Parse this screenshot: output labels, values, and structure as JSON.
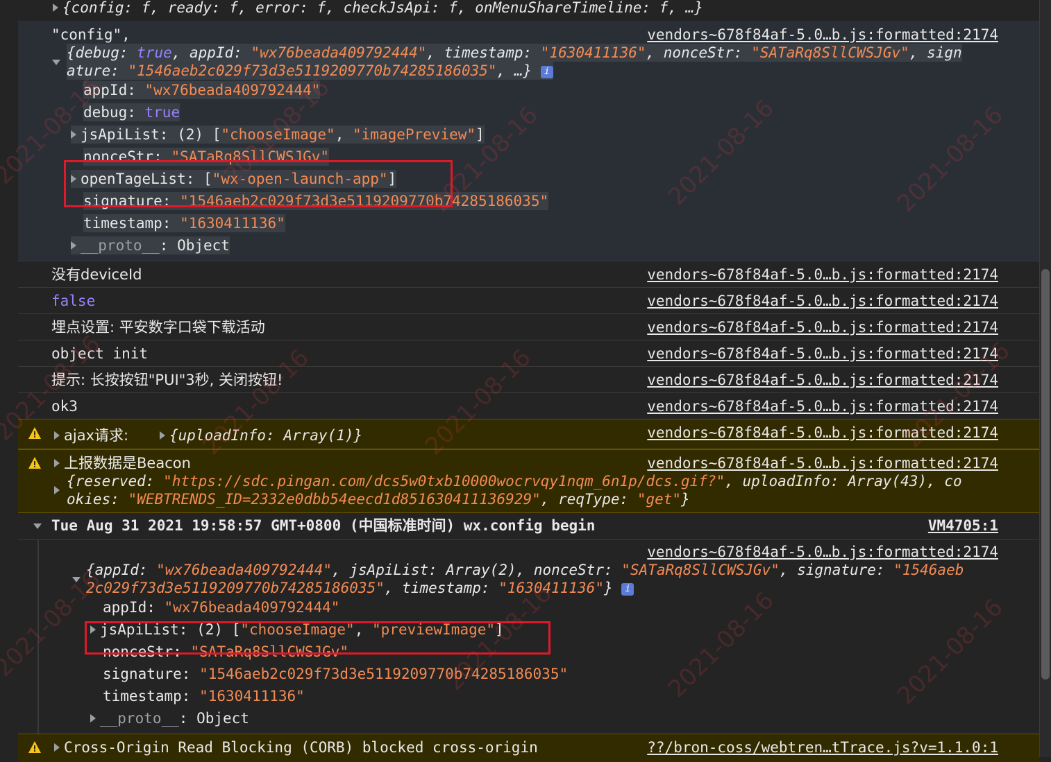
{
  "colors": {
    "background": "#242424",
    "string": "#f28b54",
    "keyword": "#9980ff",
    "warning_bg": "#332b00",
    "highlight": "#e0192a"
  },
  "top_line": "{config: f, ready: f, error: f, checkJsApi: f, onMenuShareTimeline: f, …}",
  "group1": {
    "label": "\"config\",",
    "source": "vendors~678f84af-5.0…b.js:formatted:2174",
    "summary_parts": {
      "open": "{debug: ",
      "debug_val": "true",
      "appid_key": ", appId: ",
      "appid_val": "\"wx76beada409792444\"",
      "ts_key": ", timestamp: ",
      "ts_val": "\"1630411136\"",
      "nonce_key": ", nonceStr: ",
      "nonce_val": "\"SATaRq8SllCWSJGv\"",
      "sign_key": ", sign",
      "line2_key": "ature: ",
      "line2_val": "\"1546aeb2c029f73d3e5119209770b74285186035\"",
      "line2_end": ", …}"
    },
    "info": "i",
    "props": [
      {
        "key": "appId",
        "val": "\"wx76beada409792444\""
      },
      {
        "key": "debug",
        "val": "true"
      },
      {
        "key": "jsApiList",
        "count": "(2)",
        "open": "[",
        "a": "\"chooseImage\"",
        "sep": ", ",
        "b": "\"imagePreview\"",
        "close": "]"
      },
      {
        "key": "nonceStr",
        "val": "\"SATaRq8SllCWSJGv\""
      },
      {
        "key": "openTageList",
        "open": "[",
        "a": "\"wx-open-launch-app\"",
        "close": "]"
      },
      {
        "key": "signature",
        "val": "\"1546aeb2c029f73d3e5119209770b74285186035\""
      },
      {
        "key": "timestamp",
        "val": "\"1630411136\""
      },
      {
        "key": "__proto__",
        "val": "Object"
      }
    ]
  },
  "log_rows": [
    {
      "text": "没有deviceId",
      "source": "vendors~678f84af-5.0…b.js:formatted:2174"
    },
    {
      "text": "false",
      "source": "vendors~678f84af-5.0…b.js:formatted:2174"
    },
    {
      "text": "埋点设置: 平安数字口袋下载活动",
      "source": "vendors~678f84af-5.0…b.js:formatted:2174"
    },
    {
      "text": "object init",
      "source": "vendors~678f84af-5.0…b.js:formatted:2174"
    },
    {
      "text": "提示: 长按按钮\"PUI\"3秒, 关闭按钮!",
      "source": "vendors~678f84af-5.0…b.js:formatted:2174"
    },
    {
      "text": "ok3",
      "source": "vendors~678f84af-5.0…b.js:formatted:2174"
    }
  ],
  "warn1": {
    "label": "ajax请求:",
    "obj": "{uploadInfo: Array(1)}",
    "source": "vendors~678f84af-5.0…b.js:formatted:2174"
  },
  "warn2": {
    "label": "上报数据是Beacon",
    "source": "vendors~678f84af-5.0…b.js:formatted:2174",
    "l1_key": "{reserved: ",
    "l1_val": "\"https://sdc.pingan.com/dcs5w0txb10000wocrvqy1nqm_6n1p/dcs.gif?\"",
    "l1_end": ", uploadInfo: Array(43), co",
    "l2_key": "okies: ",
    "l2_val": "\"WEBTRENDS_ID=2332e0dbb54eecd1d851630411136929\"",
    "l2_mid": ", reqType: ",
    "l2_val2": "\"get\"",
    "l2_end": "}"
  },
  "group2": {
    "title": "Tue Aug 31 2021 19:58:57 GMT+0800 (中国标准时间) wx.config begin",
    "title_source": "VM4705:1",
    "source": "vendors~678f84af-5.0…b.js:formatted:2174",
    "s_open": "{appId: ",
    "s_appid": "\"wx76beada409792444\"",
    "s_js": ", jsApiList: Array(2), nonceStr: ",
    "s_nonce": "\"SATaRq8SllCWSJGv\"",
    "s_sig": ", signature: ",
    "s_sig1": "\"1546aeb",
    "s_sig2": "2c029f73d3e5119209770b74285186035\"",
    "s_ts": ", timestamp: ",
    "s_tsv": "\"1630411136\"",
    "s_end": "}",
    "info": "i",
    "props": [
      {
        "key": "appId",
        "val": "\"wx76beada409792444\""
      },
      {
        "key": "jsApiList",
        "count": "(2)",
        "open": "[",
        "a": "\"chooseImage\"",
        "sep": ", ",
        "b": "\"previewImage\"",
        "close": "]"
      },
      {
        "key": "nonceStr",
        "val": "\"SATaRq8SllCWSJGv\""
      },
      {
        "key": "signature",
        "val": "\"1546aeb2c029f73d3e5119209770b74285186035\""
      },
      {
        "key": "timestamp",
        "val": "\"1630411136\""
      },
      {
        "key": "__proto__",
        "val": "Object"
      }
    ]
  },
  "warn3": {
    "text": "Cross-Origin Read Blocking (CORB) blocked cross-origin",
    "source": "??/bron-coss/webtren…tTrace.js?v=1.1.0:1"
  },
  "watermark_text": "2021-08-16"
}
